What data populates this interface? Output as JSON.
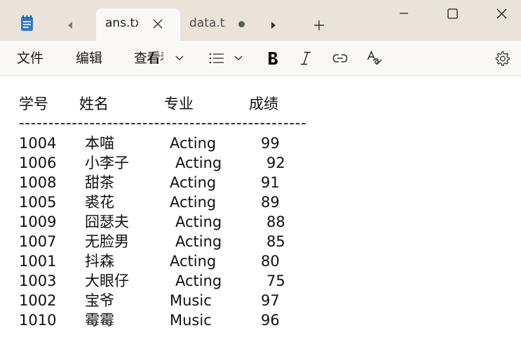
{
  "window": {
    "tabs": [
      {
        "label": "ans.txt",
        "active": true
      },
      {
        "label": "data.txt",
        "active": false,
        "unsaved": true
      }
    ]
  },
  "menu": {
    "file": "文件",
    "edit": "编辑",
    "view": "查看",
    "view_overlap": "看看"
  },
  "document": {
    "headers": [
      "学号",
      "姓名",
      "专业",
      "成绩"
    ],
    "separator": "-------------------------------------------------",
    "rows": [
      {
        "id": "1004",
        "name": "本喵",
        "major": "Acting",
        "score": "99"
      },
      {
        "id": "1006",
        "name": "小李子",
        "major": "Acting",
        "score": "92"
      },
      {
        "id": "1008",
        "name": "甜茶",
        "major": "Acting",
        "score": "91"
      },
      {
        "id": "1005",
        "name": "裘花",
        "major": "Acting",
        "score": "89"
      },
      {
        "id": "1009",
        "name": "囧瑟夫",
        "major": "Acting",
        "score": "88"
      },
      {
        "id": "1007",
        "name": "无脸男",
        "major": "Acting",
        "score": "85"
      },
      {
        "id": "1001",
        "name": "抖森",
        "major": "Acting",
        "score": "80"
      },
      {
        "id": "1003",
        "name": "大眼仔",
        "major": "Acting",
        "score": "75"
      },
      {
        "id": "1002",
        "name": "宝爷",
        "major": "Music",
        "score": "97"
      },
      {
        "id": "1010",
        "name": "霉霉",
        "major": "Music",
        "score": "96"
      }
    ]
  },
  "colors": {
    "titlebar": "#e9e3da",
    "active_tab": "#f9f8f6",
    "app_icon": "#2b7bd4"
  }
}
